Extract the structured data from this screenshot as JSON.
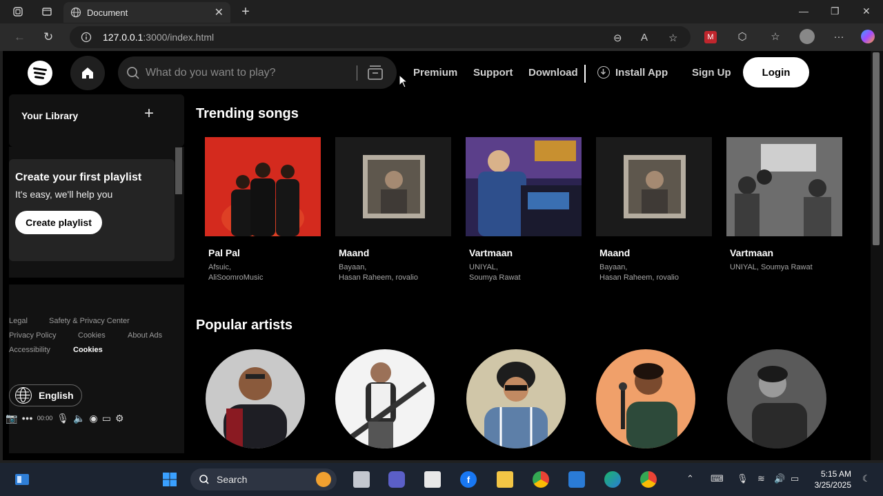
{
  "browser": {
    "tab_title": "Document",
    "url_host": "127.0.0.1",
    "url_path": ":3000/index.html"
  },
  "app": {
    "search_placeholder": "What do you want to play?",
    "nav": {
      "premium": "Premium",
      "support": "Support",
      "download": "Download",
      "install": "Install App",
      "signup": "Sign Up",
      "login": "Login"
    },
    "library": {
      "title": "Your Library",
      "plus": "+",
      "card_title": "Create your first playlist",
      "card_sub": "It's easy, we'll help you",
      "card_button": "Create playlist"
    },
    "footer_links": {
      "legal": "Legal",
      "safety": "Safety & Privacy Center",
      "privacy": "Privacy Policy",
      "cookies": "Cookies",
      "about_ads": "About Ads",
      "accessibility": "Accessibility",
      "cookies_bold": "Cookies"
    },
    "language": "English",
    "recorder_time": "00:00"
  },
  "trending": {
    "title": "Trending songs",
    "songs": [
      {
        "title": "Pal Pal",
        "artist": "Afsuic,\nAliSoomroMusic"
      },
      {
        "title": "Maand",
        "artist": "Bayaan,\nHasan Raheem, rovalio"
      },
      {
        "title": "Vartmaan",
        "artist": "UNIYAL,\nSoumya Rawat"
      },
      {
        "title": "Maand",
        "artist": "Bayaan,\nHasan Raheem, rovalio"
      },
      {
        "title": "Vartmaan",
        "artist": "UNIYAL, Soumya Rawat"
      }
    ]
  },
  "popular": {
    "title": "Popular artists"
  },
  "taskbar": {
    "search": "Search",
    "time": "5:15 AM",
    "date": "3/25/2025"
  },
  "colors": {
    "page_bg": "#000000",
    "panel_bg": "#121212",
    "card_bg": "#242424",
    "accent_red": "#d42a1e"
  }
}
